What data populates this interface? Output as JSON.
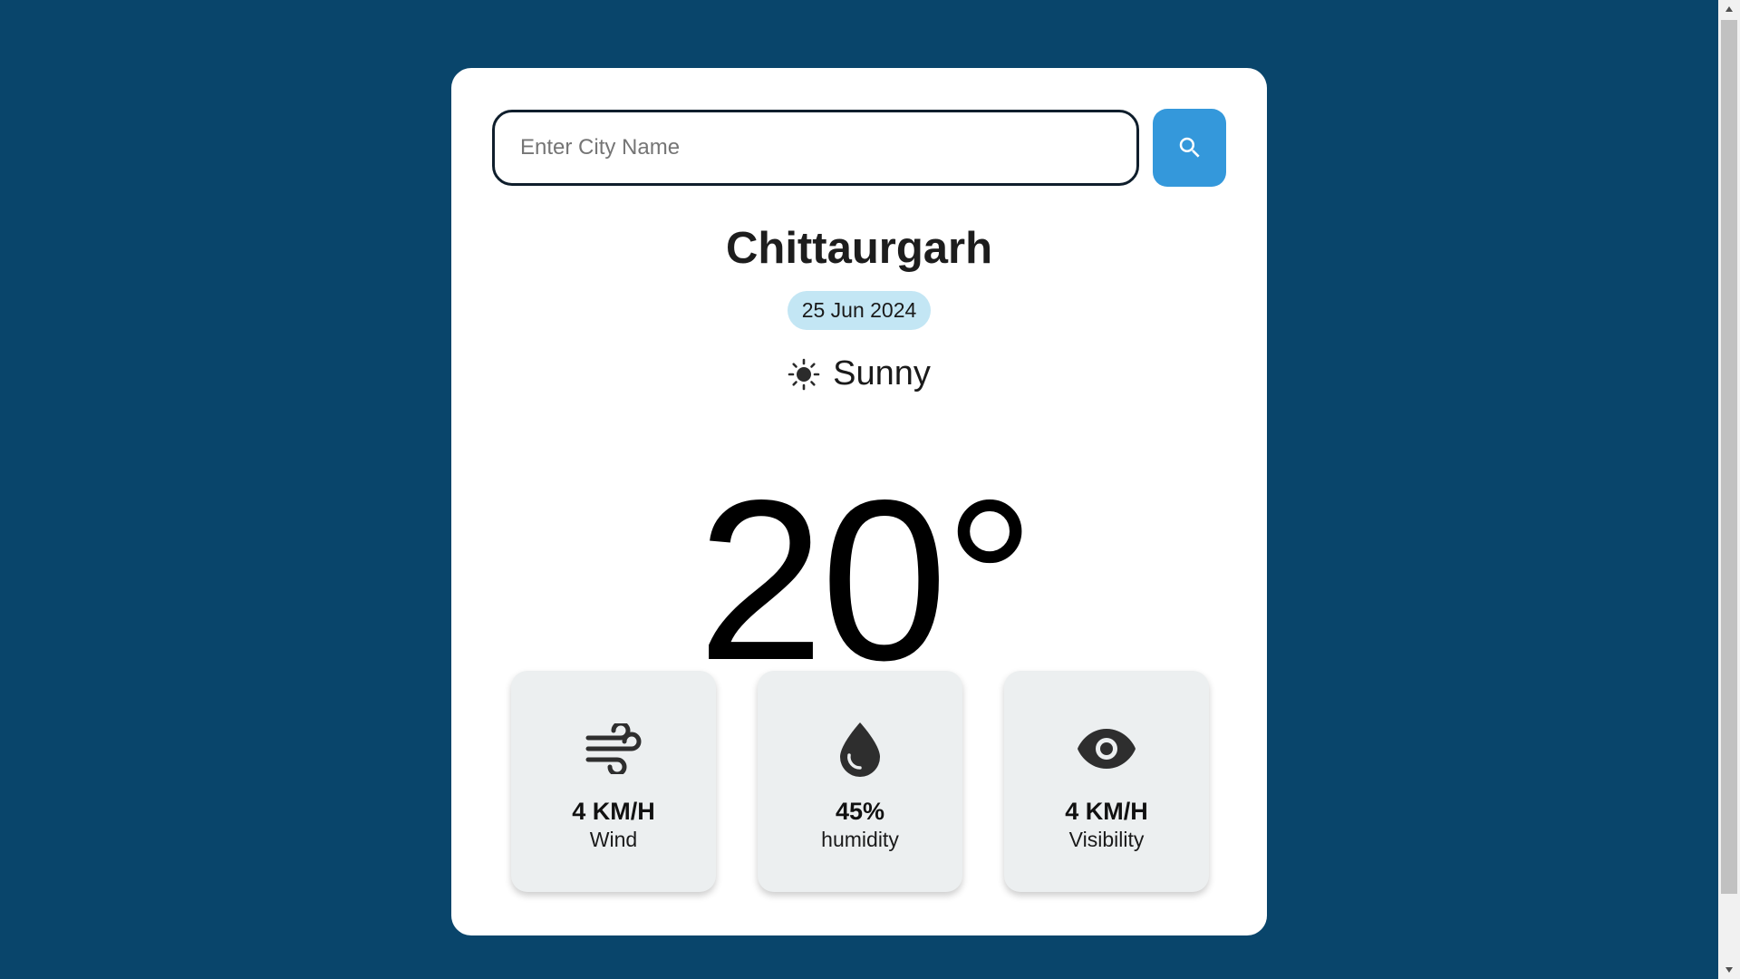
{
  "search": {
    "placeholder": "Enter City Name",
    "value": "",
    "button_icon": "search-icon"
  },
  "weather": {
    "city": "Chittaurgarh",
    "date": "25 Jun 2024",
    "condition": "Sunny",
    "condition_icon": "sun-icon",
    "temperature": "20°"
  },
  "stats": [
    {
      "icon": "wind-icon",
      "value": "4 KM/H",
      "label": "Wind"
    },
    {
      "icon": "water-drop-icon",
      "value": "45%",
      "label": "humidity"
    },
    {
      "icon": "eye-icon",
      "value": "4 KM/H",
      "label": "Visibility"
    }
  ],
  "colors": {
    "background": "#09456b",
    "card": "#ffffff",
    "accent": "#3498db",
    "date_badge": "#c3e6f4",
    "stat_card": "#eceff0"
  }
}
